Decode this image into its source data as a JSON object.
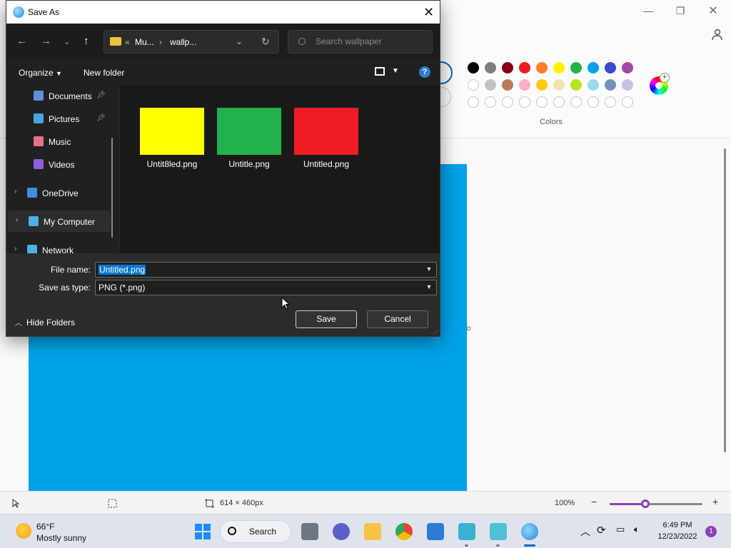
{
  "dialog": {
    "title": "Save As",
    "nav": {
      "address_segments": [
        "Mu...",
        "wallp..."
      ],
      "address_prefix": "«",
      "search_placeholder": "Search wallpaper"
    },
    "commands": {
      "organize": "Organize",
      "new_folder": "New folder",
      "help": "?"
    },
    "sidebar": [
      {
        "label": "Documents",
        "icon": "document-icon",
        "pinned": true,
        "color": "#5e8fd9"
      },
      {
        "label": "Pictures",
        "icon": "pictures-icon",
        "pinned": true,
        "color": "#4aa3e0"
      },
      {
        "label": "Music",
        "icon": "music-icon",
        "pinned": false,
        "color": "#e8718a"
      },
      {
        "label": "Videos",
        "icon": "videos-icon",
        "pinned": false,
        "color": "#8b5fd6"
      },
      {
        "label": "OneDrive",
        "icon": "cloud-icon",
        "expandable": true,
        "color": "#3d8fe0"
      },
      {
        "label": "My Computer",
        "icon": "computer-icon",
        "expandable": true,
        "selected": true,
        "color": "#4ab0e8"
      },
      {
        "label": "Network",
        "icon": "network-icon",
        "expandable": true,
        "color": "#4ab0e8"
      }
    ],
    "files": [
      {
        "name": "Untit8led.png",
        "color": "#ffff00"
      },
      {
        "name": "Untitle.png",
        "color": "#22b14c"
      },
      {
        "name": "Untitled.png",
        "color": "#ed1c24"
      }
    ],
    "form": {
      "file_name_label": "File name:",
      "file_name_value": "Untitled.png",
      "save_type_label": "Save as type:",
      "save_type_value": "PNG (*.png)"
    },
    "buttons": {
      "save": "Save",
      "cancel": "Cancel",
      "hide_folders": "Hide Folders"
    }
  },
  "paint": {
    "colors_label": "Colors",
    "palette_row1": [
      "#000000",
      "#7f7f7f",
      "#880015",
      "#ed1c24",
      "#ff7f27",
      "#fff200",
      "#22b14c",
      "#00a2e8",
      "#3f48cc",
      "#a349a4"
    ],
    "palette_row2": [
      "#ffffff",
      "#c3c3c3",
      "#b97a57",
      "#ffaec9",
      "#ffc90e",
      "#efe4b0",
      "#b5e61d",
      "#99d9ea",
      "#7092be",
      "#c8bfe7"
    ],
    "empty_slots": 10,
    "canvas_color": "#00a2e8",
    "status": {
      "size": "614 × 460px",
      "zoom": "100%",
      "zoom_level": 0.35
    }
  },
  "taskbar": {
    "weather_temp": "66°F",
    "weather_desc": "Mostly sunny",
    "search_label": "Search",
    "time": "6:49 PM",
    "date": "12/23/2022",
    "notifications": "1"
  }
}
